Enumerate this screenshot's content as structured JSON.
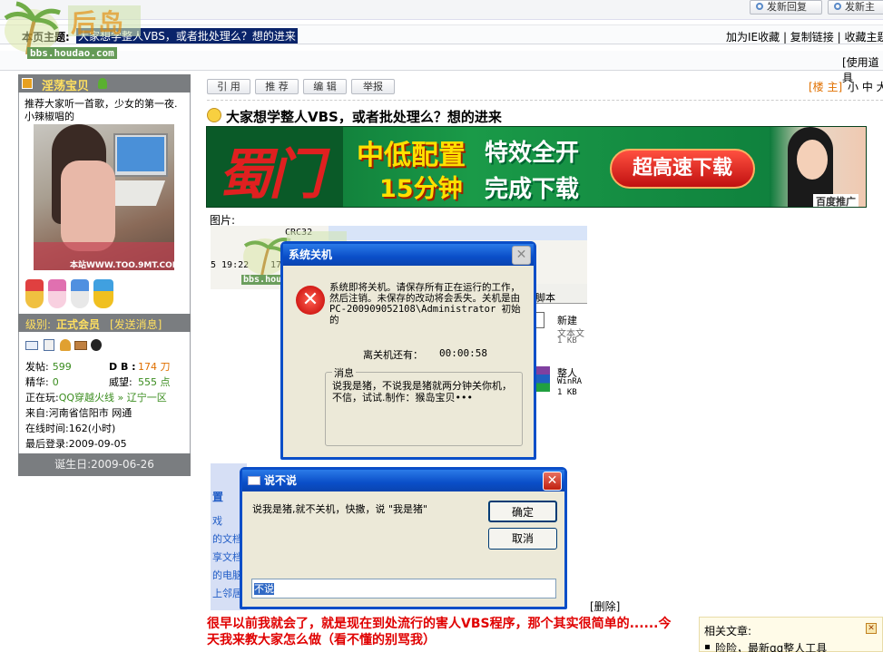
{
  "topbar": {
    "reply_btn": "发新回复",
    "new_btn": "发新主"
  },
  "header": {
    "topic_prefix": "本页主题:",
    "topic": "大家想学整人VBS，或者批处理么？想的进来",
    "links": [
      "加为IE收藏",
      "复制链接",
      "收藏主题"
    ],
    "tools": "[使用道具"
  },
  "logo": {
    "text": "后岛",
    "url": "bbs.houdao.com"
  },
  "user": {
    "name": "淫荡宝贝",
    "intro": "推荐大家听一首歌，少女的第一夜.小辣椒唱的",
    "photo_watermark": "本站WWW.TOO.9MT.COM.CN",
    "level_label": "级别:",
    "level": "正式会员",
    "send_msg": "[发送消息]",
    "stats": {
      "posts_label": "发帖:",
      "posts": "599",
      "db_label": "D B :",
      "db": "174 刀",
      "elite_label": "精华:",
      "elite": "0",
      "prestige_label": "威望:",
      "prestige": "555 点",
      "playing_label": "正在玩:",
      "playing": "QQ穿越火线 » 辽宁一区",
      "from_label": "来自:",
      "from": "河南省信阳市 网通",
      "online": "在线时间:162(小时)",
      "last_login": "最后登录:2009-09-05"
    },
    "birthday": "诞生日:2009-06-26"
  },
  "post_toolbar": {
    "buttons": [
      "引 用",
      "推 荐",
      "编 辑",
      "举报"
    ],
    "floor": "[楼 主]",
    "font_sizes": "小 中 大"
  },
  "post": {
    "title": "大家想学整人VBS，或者批处理么？想的进来",
    "image_label": "图片:",
    "delete": "[删除]",
    "body": "很早以前我就会了，就是现在到处流行的害人VBS程序，那个其实很简单的......今天我来教大家怎么做（看不懂的别骂我）"
  },
  "banner": {
    "brand": "蜀门",
    "line1a": "中低配置",
    "line1b": "特效全开",
    "line2a": "15分钟",
    "line2b": "完成下载",
    "button": "超高速下载",
    "badge": "百度推广"
  },
  "shutdown_dialog": {
    "title": "系统关机",
    "message": "系统即将关机。请保存所有正在运行的工作，然后注销。未保存的改动将会丢失。关机是由 PC-200909052108\\Administrator 初始的",
    "countdown_label": "离关机还有：",
    "countdown": "00:00:58",
    "group_label": "消息",
    "group_text": "说我是猪，不说我是猪就两分钟关你机，不信，试试.制作：猴岛宝贝•••"
  },
  "say_dialog": {
    "title": "说不说",
    "prompt": "说我是猪,就不关机，快撒，说 \"我是猪\"",
    "ok": "确定",
    "cancel": "取消",
    "input_value": "不说"
  },
  "bg_window": {
    "col_crc": "CRC32",
    "col_time": "5 19:22",
    "col_num": "17",
    "script_label": "脚本",
    "file1_name": "新建",
    "file1_type": "文本文",
    "file1_size": "1 KB",
    "file2_name": "整人",
    "file2_type": "WinRA",
    "file2_size": "1 KB",
    "side_title": "置",
    "side_links": [
      "戏",
      "的文档",
      "享文档",
      "的电脑",
      "上邻居"
    ]
  },
  "related": {
    "title": "相关文章:",
    "item1": "险险，最新qq整人工具"
  },
  "colors": {
    "accent": "#0a4ec8",
    "user_header": "#7a7d80",
    "level": "#f5f5f5",
    "red": "#e00000"
  }
}
